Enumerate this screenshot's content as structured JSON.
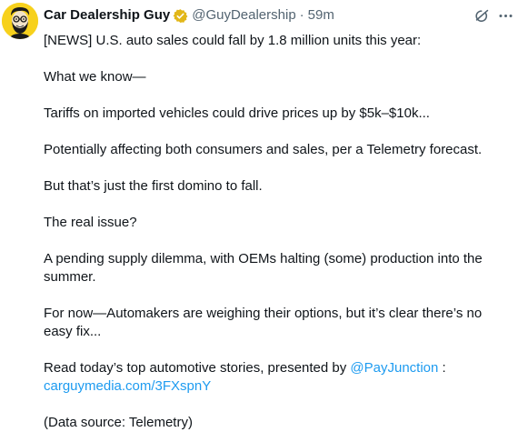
{
  "author": {
    "display_name": "Car Dealership Guy",
    "handle": "@GuyDealership",
    "separator": "·",
    "time": "59m",
    "verified_color": "#e2b719",
    "avatar_bg": "#f7d11c"
  },
  "actions": {
    "grok_icon": "grok-icon",
    "more_icon": "more-icon"
  },
  "tweet": {
    "p1": "[NEWS] U.S. auto sales could fall by 1.8 million units this year:",
    "p2": "What we know—",
    "p3": "Tariffs on imported vehicles could drive prices up by $5k–$10k...",
    "p4": "Potentially affecting both consumers and sales, per a Telemetry forecast.",
    "p5": "But that’s just the first domino to fall.",
    "p6": "The real issue?",
    "p7": "A pending supply dilemma, with OEMs halting (some) production into the summer.",
    "p8": "For now—Automakers are weighing their options, but it’s clear there’s no easy fix...",
    "p9_prefix": "Read today’s top automotive stories, presented by ",
    "p9_mention": "@PayJunction",
    "p9_suffix": " :",
    "p9_url": "carguymedia.com/3FXspnY",
    "p10": "(Data source: Telemetry)"
  },
  "colors": {
    "text": "#0f1419",
    "secondary": "#536471",
    "link": "#1d9bf0"
  }
}
